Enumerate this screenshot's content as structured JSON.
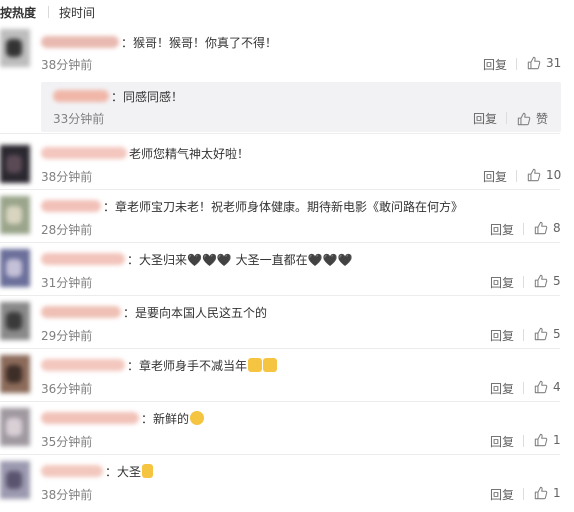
{
  "sort": {
    "hot": "按热度",
    "time": "按时间"
  },
  "comments": [
    {
      "text": "：猴哥！猴哥！你真了不得！",
      "time": "38分钟前",
      "reply": "回复",
      "likes": "31"
    },
    {
      "text": "：同感同感！",
      "time": "33分钟前",
      "reply": "回复",
      "likes": "赞"
    },
    {
      "text": "老师您精气神太好啦！",
      "time": "38分钟前",
      "reply": "回复",
      "likes": "10"
    },
    {
      "text": "：章老师宝刀未老！祝老师身体健康。期待新电影《敢问路在何方》",
      "time": "28分钟前",
      "reply": "回复",
      "likes": "8"
    },
    {
      "text": "：大圣归来🖤🖤🖤 大圣一直都在🖤🖤🖤",
      "time": "31分钟前",
      "reply": "回复",
      "likes": "5"
    },
    {
      "text": "：是要向本国人民这五个的",
      "time": "29分钟前",
      "reply": "回复",
      "likes": "5"
    },
    {
      "text": "：章老师身手不减当年",
      "time": "36分钟前",
      "reply": "回复",
      "likes": "4"
    },
    {
      "text": "：新鲜的",
      "time": "35分钟前",
      "reply": "回复",
      "likes": "1"
    },
    {
      "text": "：大圣",
      "time": "38分钟前",
      "reply": "回复",
      "likes": "1"
    }
  ],
  "colors": {
    "like_icon": "#808080",
    "sub_bg": "#f2f2f5",
    "emoji_yellow": "#f5c542"
  },
  "icons": {
    "like": "thumbs-up-icon",
    "emoji_thumbs": "thumbs-up-emoji",
    "emoji_face": "crying-face-emoji",
    "emoji_victory": "victory-hand-emoji"
  }
}
